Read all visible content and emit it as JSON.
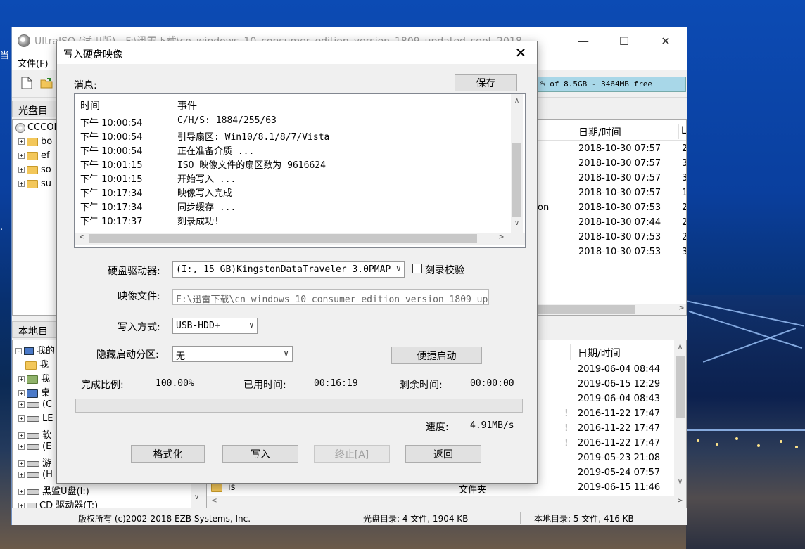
{
  "desktop": {
    "edge_text_1": "当",
    "edge_text_2": "."
  },
  "main_window": {
    "title": "UltraISO (试用版) - F:\\迅雷下载\\cn_windows_10_consumer_edition_version_1809_updated_sept_2018_...",
    "minimize_glyph": "—",
    "maximize_glyph": "☐",
    "close_glyph": "✕",
    "menu": {
      "file_label": "文件(F)"
    },
    "capacity_text": "% of 8.5GB - 3464MB free",
    "cd_pane": {
      "header": "光盘目录",
      "root": "CCCOM",
      "folders": [
        "bo",
        "ef",
        "so",
        "su"
      ],
      "date_column": "日期/时间",
      "last_column": "L",
      "rows": [
        {
          "name": "",
          "date": "2018-10-30 07:57",
          "l": "2"
        },
        {
          "name": "",
          "date": "2018-10-30 07:57",
          "l": "3"
        },
        {
          "name": "",
          "date": "2018-10-30 07:57",
          "l": "3"
        },
        {
          "name": "",
          "date": "2018-10-30 07:57",
          "l": "1"
        },
        {
          "name": "on",
          "date": "2018-10-30 07:53",
          "l": "2"
        },
        {
          "name": "",
          "date": "2018-10-30 07:44",
          "l": "2"
        },
        {
          "name": "",
          "date": "2018-10-30 07:53",
          "l": "2"
        },
        {
          "name": "",
          "date": "2018-10-30 07:53",
          "l": "3"
        }
      ]
    },
    "local_pane": {
      "header": "本地目录",
      "tree": [
        "我的电",
        "我",
        "我",
        "桌",
        "(C",
        "LE",
        "软",
        "(E",
        "游",
        "(H",
        "黑鲨U盘(I:)",
        "CD 驱动器(T:)"
      ],
      "date_column": "日期/时间",
      "rows": [
        {
          "mark": "",
          "date": "2019-06-04 08:44"
        },
        {
          "mark": "",
          "date": "2019-06-15 12:29"
        },
        {
          "mark": "",
          "date": "2019-06-04 08:43"
        },
        {
          "mark": "!",
          "date": "2016-11-22 17:47"
        },
        {
          "mark": "!",
          "date": "2016-11-22 17:47"
        },
        {
          "mark": "!",
          "date": "2016-11-22 17:47"
        },
        {
          "mark": "",
          "date": "2019-05-23 21:08"
        },
        {
          "mark": "",
          "date": "2019-05-24 07:57"
        },
        {
          "mark": "",
          "date": "2019-06-15 11:46"
        }
      ],
      "last_row_name": "is",
      "last_row_type": "文件夹"
    },
    "status": {
      "copyright": "版权所有 (c)2002-2018 EZB Systems, Inc.",
      "cd_dir": "光盘目录: 4 文件, 1904 KB",
      "local_dir": "本地目录: 5 文件, 416 KB"
    }
  },
  "dialog": {
    "title": "写入硬盘映像",
    "close_glyph": "✕",
    "messages_label": "消息:",
    "save_button": "保存",
    "log_columns": {
      "time": "时间",
      "event": "事件"
    },
    "log": [
      {
        "time": "下午 10:00:54",
        "event": "C/H/S: 1884/255/63"
      },
      {
        "time": "下午 10:00:54",
        "event": "引导扇区: Win10/8.1/8/7/Vista"
      },
      {
        "time": "下午 10:00:54",
        "event": "正在准备介质 ..."
      },
      {
        "time": "下午 10:01:15",
        "event": "ISO 映像文件的扇区数为 9616624"
      },
      {
        "time": "下午 10:01:15",
        "event": "开始写入 ..."
      },
      {
        "time": "下午 10:17:34",
        "event": "映像写入完成"
      },
      {
        "time": "下午 10:17:34",
        "event": "同步缓存 ..."
      },
      {
        "time": "下午 10:17:37",
        "event": "刻录成功!"
      }
    ],
    "drive_label": "硬盘驱动器:",
    "drive_value": "(I:, 15 GB)KingstonDataTraveler 3.0PMAP",
    "verify_label": "刻录校验",
    "image_label": "映像文件:",
    "image_value": "F:\\迅雷下载\\cn_windows_10_consumer_edition_version_1809_upd",
    "write_mode_label": "写入方式:",
    "write_mode_value": "USB-HDD+",
    "hidden_boot_label": "隐藏启动分区:",
    "hidden_boot_value": "无",
    "quick_boot_button": "便捷启动",
    "complete_label": "完成比例:",
    "complete_value": "100.00%",
    "elapsed_label": "已用时间:",
    "elapsed_value": "00:16:19",
    "remaining_label": "剩余时间:",
    "remaining_value": "00:00:00",
    "speed_label": "速度:",
    "speed_value": "4.91MB/s",
    "progress_fraction": 1.0,
    "format_button": "格式化",
    "write_button": "写入",
    "stop_button": "终止[A]",
    "back_button": "返回"
  }
}
